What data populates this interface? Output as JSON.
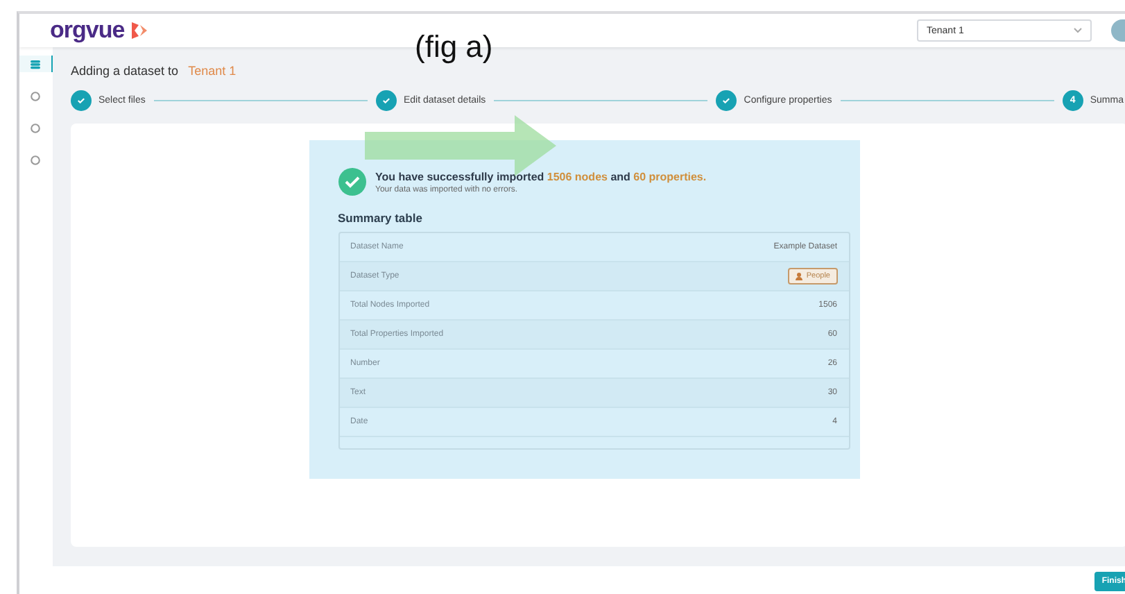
{
  "annotation": "(fig a)",
  "header": {
    "logo": "orgvue",
    "tenant_select": "Tenant 1"
  },
  "sidebar": {
    "items": [
      {
        "selected": true
      },
      {
        "selected": false
      },
      {
        "selected": false
      },
      {
        "selected": false
      }
    ]
  },
  "page_title": {
    "prefix": "Adding a dataset to",
    "tenant": "Tenant 1"
  },
  "steps": [
    {
      "label": "Select files",
      "done": true
    },
    {
      "label": "Edit dataset details",
      "done": true
    },
    {
      "label": "Configure properties",
      "done": true
    },
    {
      "label": "Summa",
      "done": false,
      "number": "4"
    }
  ],
  "result": {
    "message": "You have successfully imported **1506 nodes** and **60 properties.**",
    "detail": "Your data was imported with no errors."
  },
  "summary_table": {
    "title": "Summary table",
    "rows": [
      {
        "label": "Dataset Name",
        "value": "Example Dataset",
        "kind": "text"
      },
      {
        "label": "Dataset Type",
        "value": "People",
        "kind": "tag"
      },
      {
        "label": "Total Nodes Imported",
        "value": "1506",
        "kind": "text"
      },
      {
        "label": "Total Properties Imported",
        "value": "60",
        "kind": "text"
      },
      {
        "label": "Number",
        "value": "26",
        "kind": "text"
      },
      {
        "label": "Text",
        "value": "30",
        "kind": "text"
      },
      {
        "label": "Date",
        "value": "4",
        "kind": "text"
      }
    ]
  },
  "footer": {
    "button": "Finish"
  }
}
